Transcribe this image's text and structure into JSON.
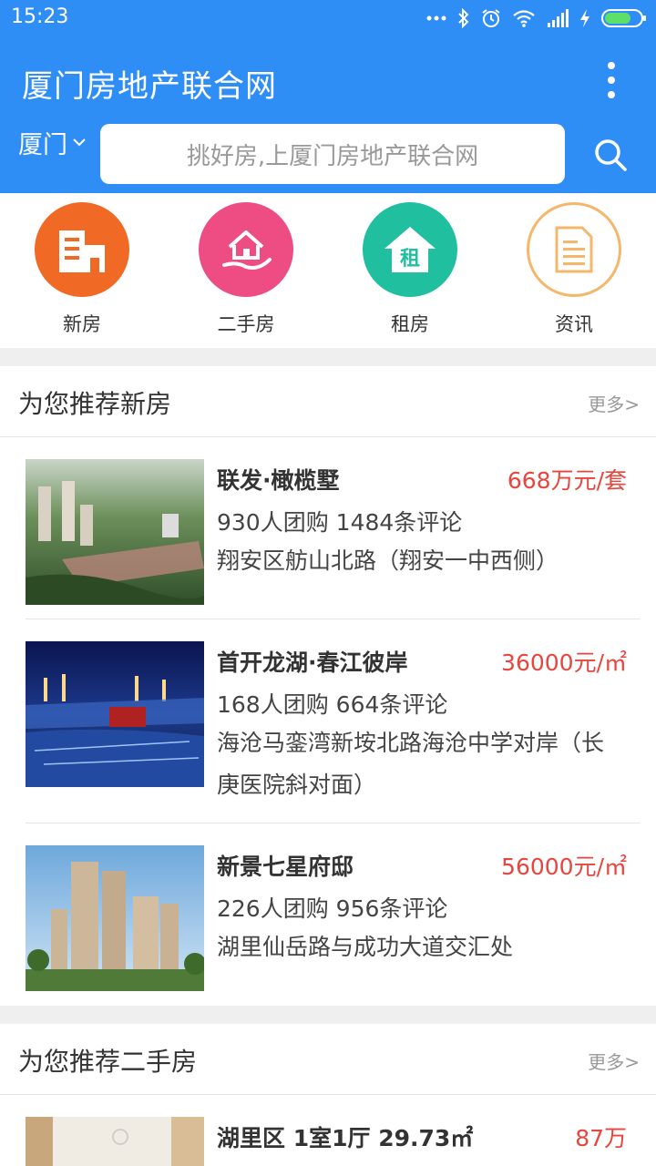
{
  "status_bar": {
    "time": "15:23"
  },
  "app_bar": {
    "title": "厦门房地产联合网",
    "city": "厦门",
    "search_placeholder": "挑好房,上厦门房地产联合网"
  },
  "categories": [
    {
      "label": "新房",
      "icon": "new-house-icon",
      "color": "#f06a25"
    },
    {
      "label": "二手房",
      "icon": "second-hand-house-icon",
      "color": "#ee4d84"
    },
    {
      "label": "租房",
      "icon": "rent-icon",
      "icon_text": "租",
      "color": "#1fbfa0"
    },
    {
      "label": "资讯",
      "icon": "news-icon",
      "color": "#f5b76b"
    }
  ],
  "new_homes": {
    "title": "为您推荐新房",
    "more": "更多>",
    "items": [
      {
        "name": "联发·橄榄墅",
        "price": "668万元/套",
        "stats": "930人团购 1484条评论",
        "address": "翔安区舫山北路（翔安一中西侧）"
      },
      {
        "name": "首开龙湖·春江彼岸",
        "price": "36000元/㎡",
        "stats": "168人团购 664条评论",
        "address": "海沧马銮湾新垵北路海沧中学对岸（长庚医院斜对面）"
      },
      {
        "name": "新景七星府邸",
        "price": "56000元/㎡",
        "stats": "226人团购 956条评论",
        "address": "湖里仙岳路与成功大道交汇处"
      }
    ]
  },
  "second_hand": {
    "title": "为您推荐二手房",
    "more": "更多>",
    "items": [
      {
        "name": "湖里区 1室1厅 29.73㎡",
        "price": "87万"
      }
    ]
  },
  "colors": {
    "primary": "#2f8ef5",
    "price": "#e8463c"
  }
}
